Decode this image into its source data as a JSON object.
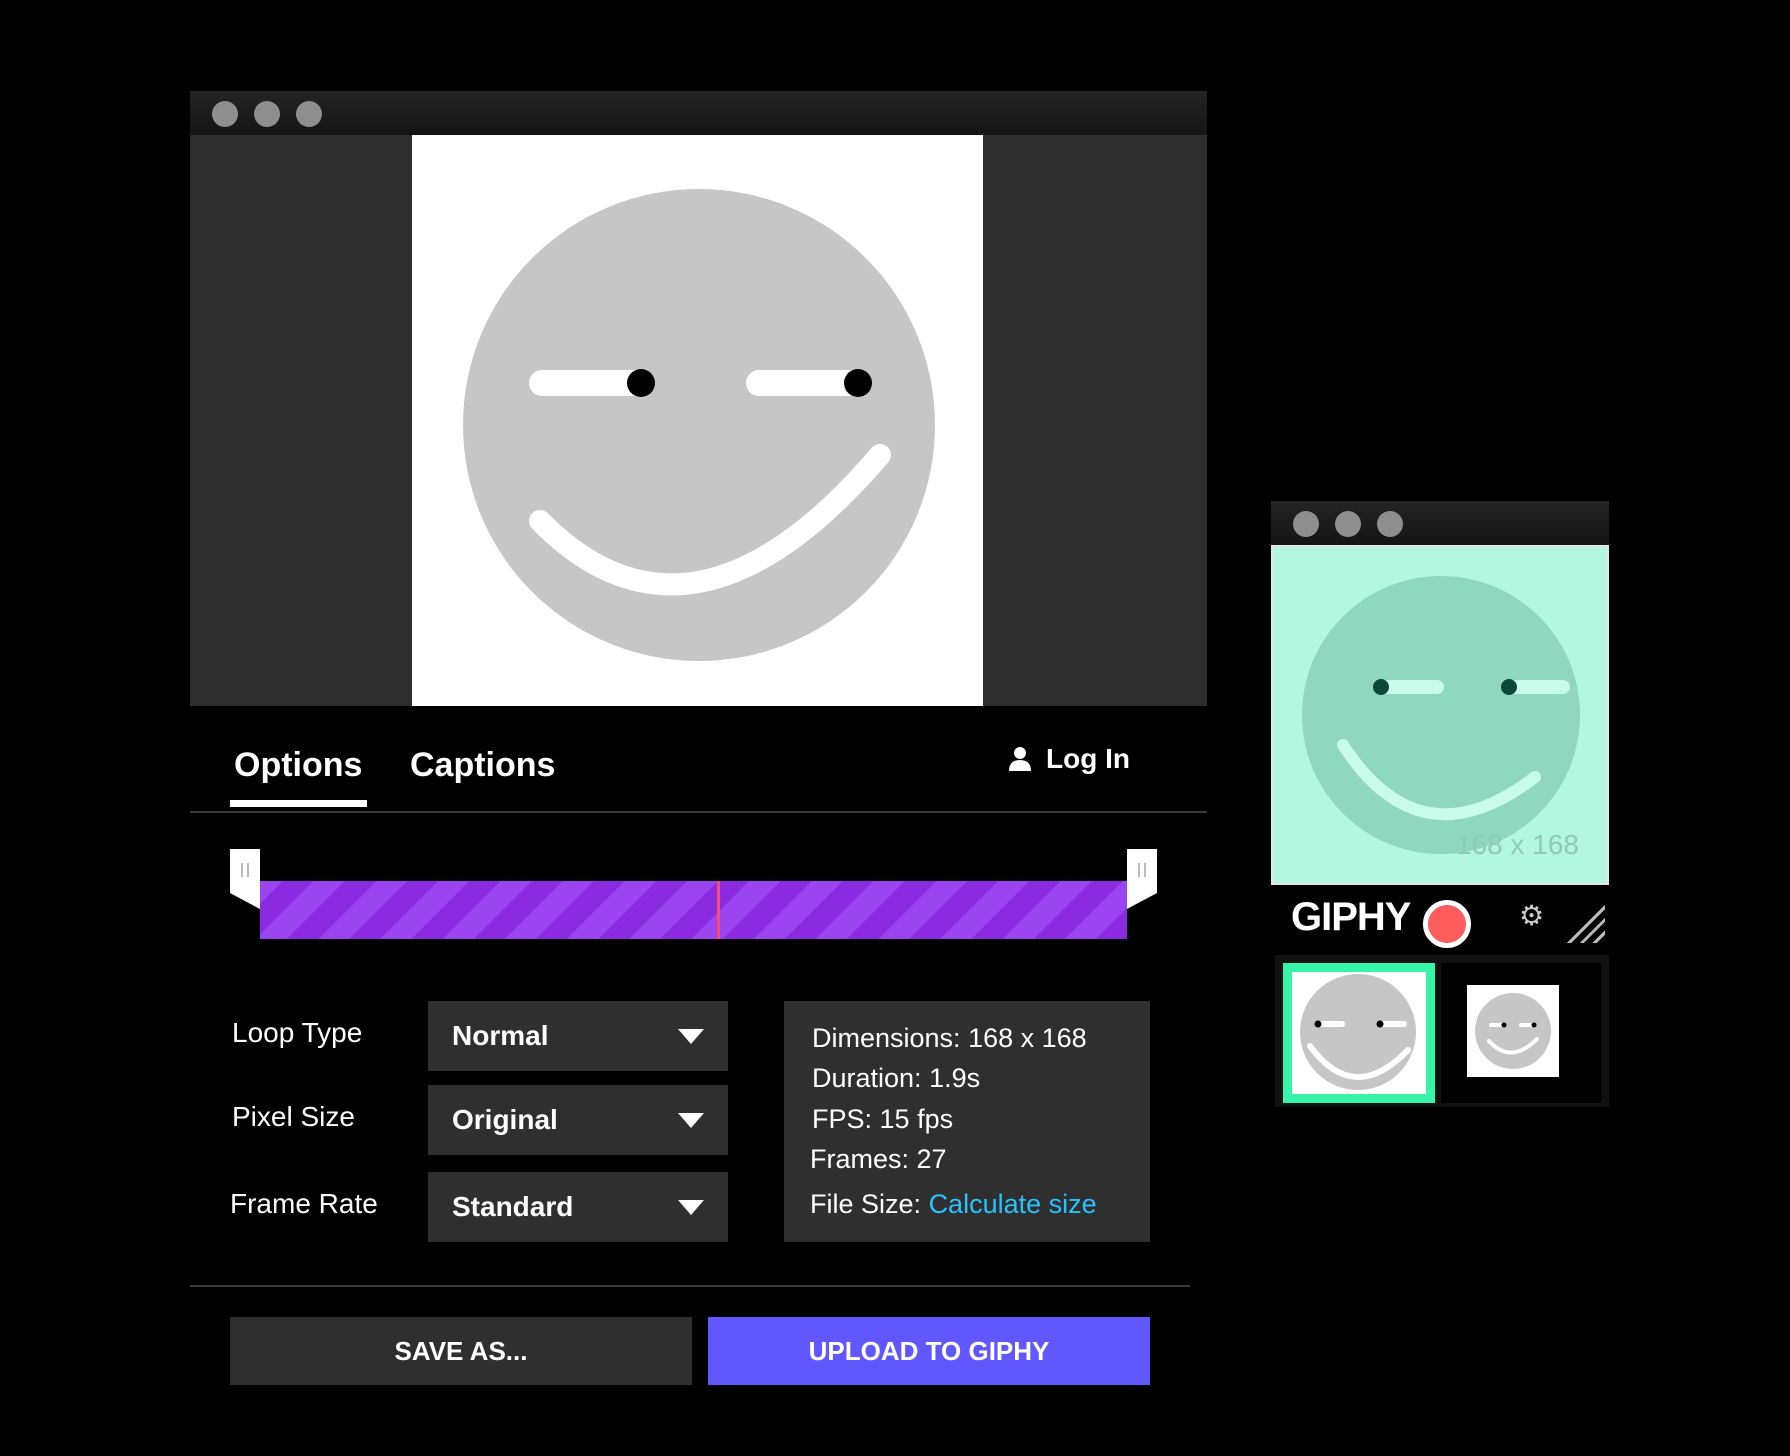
{
  "editor": {
    "tabs": [
      {
        "label": "Options",
        "active": true
      },
      {
        "label": "Captions",
        "active": false
      }
    ],
    "login_label": "Log In",
    "trim": {
      "start": 0.0,
      "end": 1.0,
      "playhead": 0.53,
      "color": "#8a2be2"
    },
    "options": [
      {
        "label": "Loop Type",
        "value": "Normal"
      },
      {
        "label": "Pixel Size",
        "value": "Original"
      },
      {
        "label": "Frame Rate",
        "value": "Standard"
      }
    ],
    "info": {
      "dimensions_label": "Dimensions:",
      "dimensions_value": "168 x 168",
      "duration_label": "Duration:",
      "duration_value": "1.9s",
      "fps_label": "FPS:",
      "fps_value": "15 fps",
      "frames_label": "Frames:",
      "frames_value": "27",
      "filesize_label": "File Size:",
      "filesize_link": "Calculate size"
    },
    "buttons": {
      "save": "SAVE AS...",
      "upload": "UPLOAD TO GIPHY"
    }
  },
  "capture": {
    "dimensions": "168 x 168",
    "brand": "GIPHY",
    "accent": "#37f4a8"
  },
  "colors": {
    "upload": "#6157ff",
    "link": "#29c2ff",
    "record": "#ff5c5c"
  }
}
